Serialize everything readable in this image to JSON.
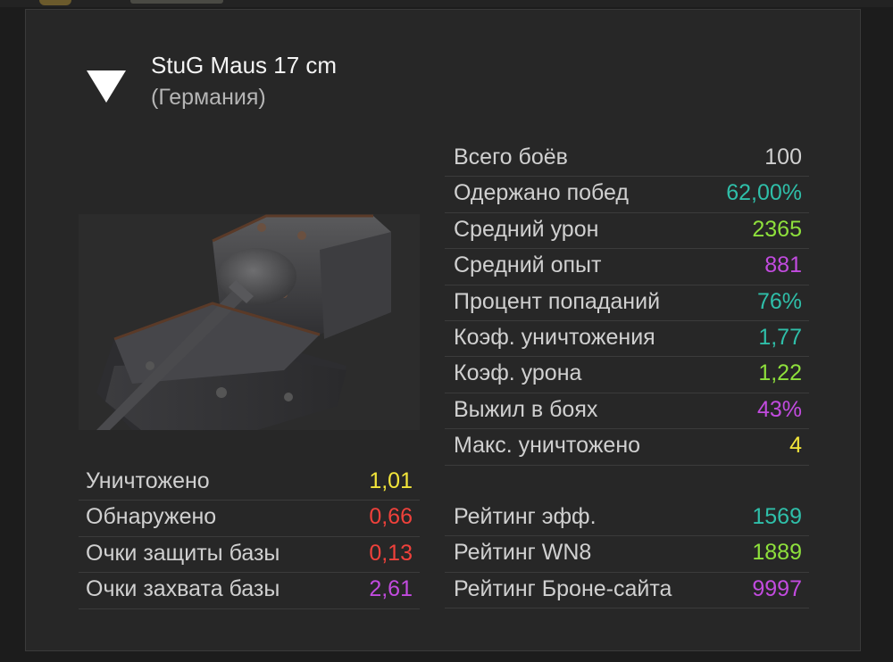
{
  "tank": {
    "name": "StuG Maus 17 cm",
    "nation": "(Германия)"
  },
  "right_stats": [
    {
      "label": "Всего боёв",
      "value": "100",
      "color": "#d0d0d0"
    },
    {
      "label": "Одержано побед",
      "value": "62,00%",
      "color": "#2fbfa9"
    },
    {
      "label": "Средний урон",
      "value": "2365",
      "color": "#8ee03c"
    },
    {
      "label": "Средний опыт",
      "value": "881",
      "color": "#c24bdf"
    },
    {
      "label": "Процент попаданий",
      "value": "76%",
      "color": "#2fbfa9"
    },
    {
      "label": "Коэф. уничтожения",
      "value": "1,77",
      "color": "#2fbfa9"
    },
    {
      "label": "Коэф. урона",
      "value": "1,22",
      "color": "#8ee03c"
    },
    {
      "label": "Выжил в боях",
      "value": "43%",
      "color": "#c24bdf"
    },
    {
      "label": "Макс. уничтожено",
      "value": "4",
      "color": "#f2e53a"
    }
  ],
  "left_stats": [
    {
      "label": "Уничтожено",
      "value": "1,01",
      "color": "#f2e53a"
    },
    {
      "label": "Обнаружено",
      "value": "0,66",
      "color": "#f0413b"
    },
    {
      "label": "Очки защиты базы",
      "value": "0,13",
      "color": "#f0413b"
    },
    {
      "label": "Очки захвата базы",
      "value": "2,61",
      "color": "#c24bdf"
    }
  ],
  "ratings": [
    {
      "label": "Рейтинг эфф.",
      "value": "1569",
      "color": "#2fbfa9"
    },
    {
      "label": "Рейтинг WN8",
      "value": "1889",
      "color": "#8ee03c"
    },
    {
      "label": "Рейтинг Броне-сайта",
      "value": "9997",
      "color": "#c24bdf"
    }
  ],
  "icons": {
    "toggle": "triangle-down-icon",
    "tank": "tank-image"
  }
}
